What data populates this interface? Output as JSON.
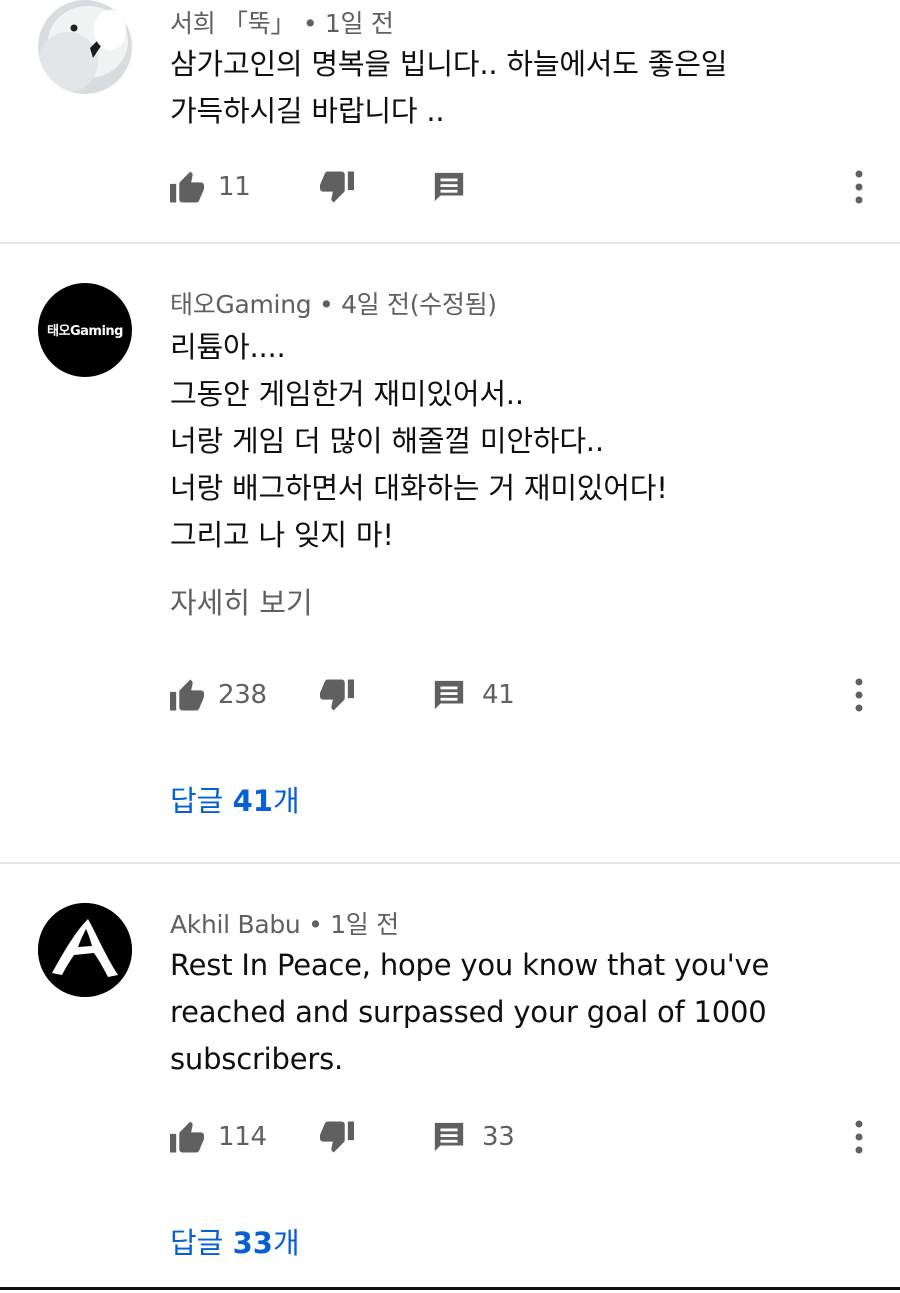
{
  "comments": [
    {
      "author": "서희 「뚝」",
      "time": "1일 전",
      "lines": [
        "삼가고인의 명복을 빕니다.. 하늘에서도  좋은일",
        "가득하시길 바랍니다 .."
      ],
      "likes": "11",
      "replies_count": "",
      "show_more": "",
      "replies_label": ""
    },
    {
      "author": "태오Gaming",
      "time": "4일 전(수정됨)",
      "avatar_text": "태오Gaming",
      "lines": [
        "리튬아....",
        "그동안 게임한거 재미있어서..",
        "너랑 게임 더 많이 해줄껄 미안하다..",
        "너랑 배그하면서 대화하는 거 재미있어다!",
        "그리고 나 잊지 마!"
      ],
      "show_more": "자세히 보기",
      "likes": "238",
      "replies_count": "41",
      "replies_prefix": "답글 ",
      "replies_number": "41",
      "replies_suffix": "개"
    },
    {
      "author": "Akhil Babu",
      "time": "1일 전",
      "lines": [
        "Rest In Peace, hope you know that you've",
        "reached and surpassed your goal of 1000",
        "subscribers."
      ],
      "likes": "114",
      "replies_count": "33",
      "replies_prefix": "답글 ",
      "replies_number": "33",
      "replies_suffix": "개"
    }
  ],
  "icons": {
    "like": "thumbs-up-icon",
    "dislike": "thumbs-down-icon",
    "reply": "comment-icon",
    "menu": "more-vert-icon"
  },
  "colors": {
    "link": "#065fd4",
    "secondary_text": "#606060",
    "divider": "#e5e5e5"
  }
}
